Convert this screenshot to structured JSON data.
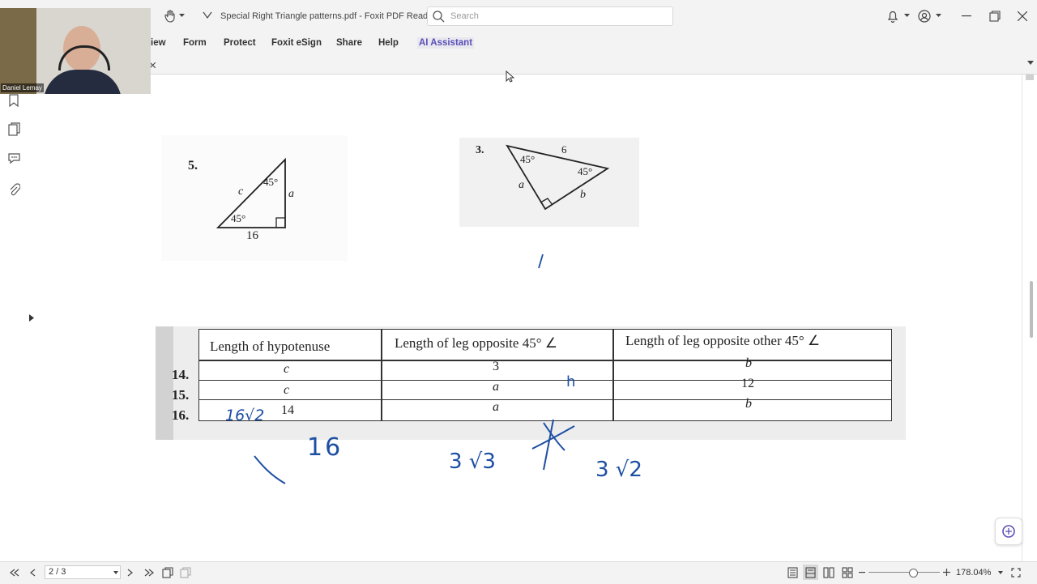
{
  "window": {
    "title": "Special Right Triangle patterns.pdf - Foxit PDF Reader"
  },
  "search": {
    "placeholder": "Search"
  },
  "ribbon": {
    "tabs": [
      "iew",
      "Form",
      "Protect",
      "Foxit eSign",
      "Share",
      "Help",
      "AI Assistant"
    ]
  },
  "webcam": {
    "name": "Daniel Lemay"
  },
  "pdf": {
    "problem5": {
      "number": "5.",
      "angle_top": "45°",
      "angle_bottom": "45°",
      "side_c": "c",
      "side_a": "a",
      "base": "16"
    },
    "problem3": {
      "number": "3.",
      "angle_left": "45°",
      "angle_right": "45°",
      "side_top": "6",
      "side_a": "a",
      "side_b": "b"
    },
    "table": {
      "headers": [
        "Length of hypotenuse",
        "Length of leg opposite 45° ∠",
        "Length of leg opposite other 45° ∠"
      ],
      "rows": [
        {
          "num": "14.",
          "cells": [
            "c",
            "3",
            "b"
          ]
        },
        {
          "num": "15.",
          "cells": [
            "c",
            "a",
            "12"
          ]
        },
        {
          "num": "16.",
          "cells": [
            "14",
            "a",
            "b"
          ]
        }
      ]
    },
    "handwriting": {
      "row16_hyp": "16√2",
      "sixteen": "16",
      "three_root3": "3 √3",
      "three_root2": "3 √2",
      "row15_leg": "h"
    }
  },
  "status": {
    "page": "2 / 3",
    "zoom": "178.04%"
  }
}
